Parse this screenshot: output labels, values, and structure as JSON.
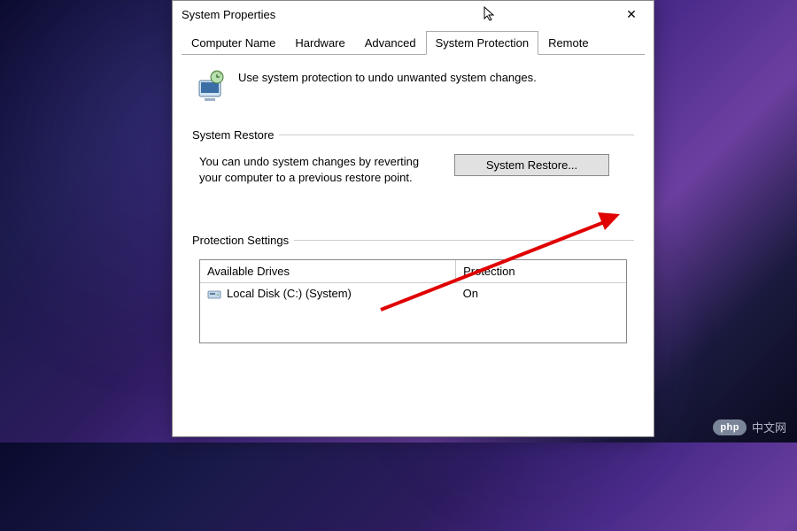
{
  "dialog": {
    "title": "System Properties",
    "closeGlyph": "✕"
  },
  "tabs": [
    {
      "label": "Computer Name"
    },
    {
      "label": "Hardware"
    },
    {
      "label": "Advanced"
    },
    {
      "label": "System Protection"
    },
    {
      "label": "Remote"
    }
  ],
  "intro": "Use system protection to undo unwanted system changes.",
  "sections": {
    "restore": {
      "title": "System Restore",
      "text": "You can undo system changes by reverting your computer to a previous restore point.",
      "button": "System Restore..."
    },
    "protection": {
      "title": "Protection Settings",
      "columns": [
        "Available Drives",
        "Protection"
      ],
      "rows": [
        {
          "drive": "Local Disk (C:) (System)",
          "protection": "On"
        }
      ]
    }
  },
  "watermark": {
    "badge": "php",
    "text": "中文网"
  }
}
